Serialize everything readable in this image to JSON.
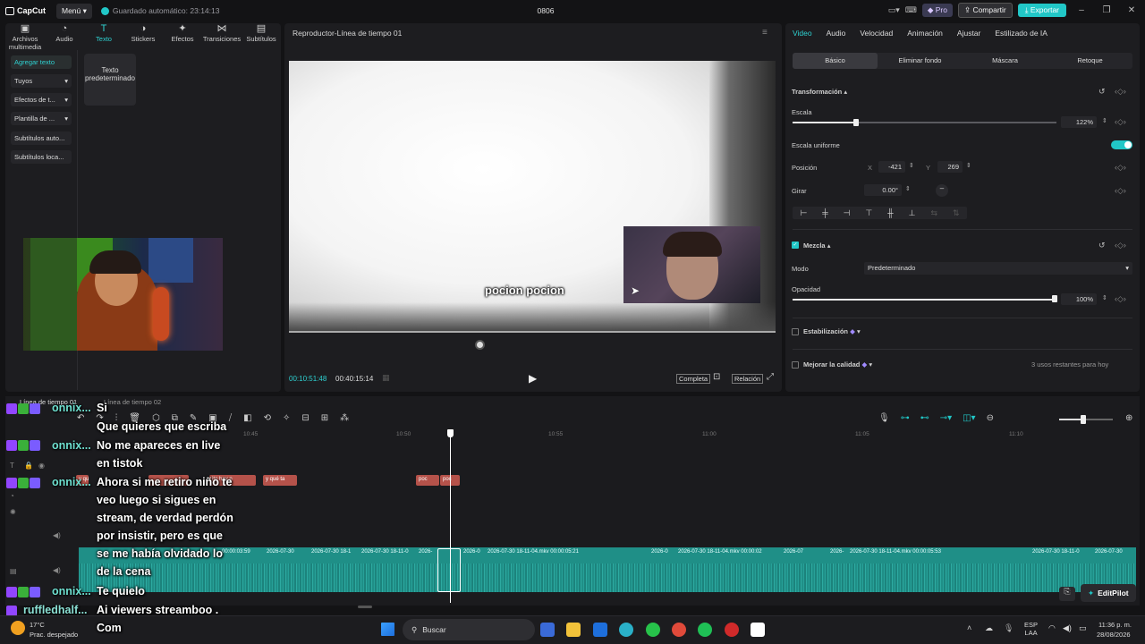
{
  "app": {
    "logo": "CapCut",
    "menu_label": "Menú",
    "autosave": "Guardado automático: 23:14:13",
    "title": "0806",
    "pro": "Pro",
    "share": "Compartir",
    "export": "Exportar"
  },
  "left_tabs": [
    {
      "label": "Archivos multimedia",
      "icon": "media-icon"
    },
    {
      "label": "Audio",
      "icon": "audio-icon"
    },
    {
      "label": "Texto",
      "icon": "text-icon"
    },
    {
      "label": "Stickers",
      "icon": "sticker-icon"
    },
    {
      "label": "Efectos",
      "icon": "effects-icon"
    },
    {
      "label": "Transiciones",
      "icon": "transition-icon"
    },
    {
      "label": "Subtítulos",
      "icon": "subtitle-icon"
    }
  ],
  "text_sidebar": [
    "Agregar texto",
    "Tuyos",
    "Efectos de t...",
    "Plantilla de ...",
    "Subtítulos auto...",
    "Subtítulos loca..."
  ],
  "text_card": "Texto predeterminado",
  "player": {
    "title": "Reproductor-Línea de tiempo 01",
    "caption": "pocion pocion",
    "current_time": "00:10:51:48",
    "total_time": "00:40:15:14",
    "complete": "Completa",
    "ratio": "Relación"
  },
  "right_tabs": [
    "Video",
    "Audio",
    "Velocidad",
    "Animación",
    "Ajustar",
    "Estilizado de IA"
  ],
  "sub_tabs": [
    "Básico",
    "Eliminar fondo",
    "Máscara",
    "Retoque"
  ],
  "props": {
    "transform": "Transformación",
    "scale": "Escala",
    "scale_value": "122%",
    "scale_fraction": 0.24,
    "uniform_scale": "Escala uniforme",
    "position": "Posición",
    "pos_x_label": "X",
    "pos_x": "-421",
    "pos_y_label": "Y",
    "pos_y": "269",
    "rotate": "Girar",
    "rotate_value": "0.00°",
    "blend": "Mezcla",
    "mode": "Modo",
    "mode_value": "Predeterminado",
    "opacity": "Opacidad",
    "opacity_value": "100%",
    "stabilization": "Estabilización",
    "improve_quality": "Mejorar la calidad",
    "remaining_uses": "3 usos restantes para hoy"
  },
  "timeline": {
    "tab1": "Línea de tiempo 01",
    "tab2": "Línea de tiempo 02",
    "ruler": [
      "10:45",
      "10:50",
      "10:55",
      "11:00",
      "11:05",
      "11:10"
    ],
    "text_clips": [
      "y que tal",
      "ito hay n",
      "y qué ta",
      "poc",
      "poc"
    ],
    "video_clips": [
      "00:00:03:59",
      "2026-07-30",
      "2026-07-30 18-1",
      "2026-07-30 18-11-0",
      "2026-",
      "2026-0",
      "2026-07-30 18-11-04.mkv  00:00:05:21",
      "2026-0",
      "2026-07-30 18-11-04.mkv  00:00:02",
      "2026-07",
      "2026-",
      "2026-07-30 18-11-04.mkv  00:00:05:53",
      "2026-07-30 18-11-0",
      "2026-07-30"
    ],
    "editpilot": "EditPilot"
  },
  "chat": [
    {
      "user": "onnix...",
      "text": "Si"
    },
    {
      "user": "",
      "text": "Que quieres que escriba"
    },
    {
      "user": "onnix...",
      "text": "No me apareces en live"
    },
    {
      "user": "",
      "text": "en tistok"
    },
    {
      "user": "onnix...",
      "text": "Ahora si me retiro niño te"
    },
    {
      "user": "",
      "text": "veo luego si sigues en"
    },
    {
      "user": "",
      "text": "stream, de verdad perdón"
    },
    {
      "user": "",
      "text": "por insistir, pero es que"
    },
    {
      "user": "",
      "text": "se me había olvidado lo"
    },
    {
      "user": "",
      "text": "de la cena"
    },
    {
      "user": "onnix...",
      "text": "Te quielo"
    },
    {
      "user": "ruffledhalf...",
      "text": "Ai viewers streamboo ."
    },
    {
      "user": "",
      "text": "Com"
    }
  ],
  "taskbar": {
    "weather_temp": "17°C",
    "weather_desc": "Prac. despejado",
    "search": "Buscar",
    "lang1": "ESP",
    "lang2": "LAA",
    "time": "11:36 p. m.",
    "date": "28/08/2026"
  },
  "colors": {
    "accent": "#21c7c7",
    "text_clip": "#b5524a",
    "video_clip": "#1f8f87"
  }
}
